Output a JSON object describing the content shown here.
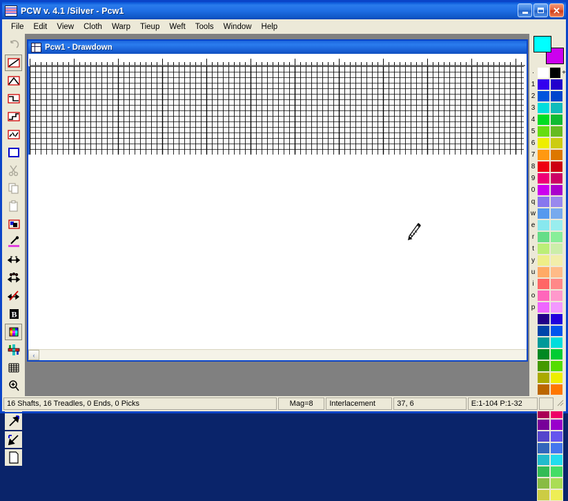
{
  "window": {
    "title": "PCW v. 4.1 /Silver - Pcw1",
    "icon": "weave-loom-icon",
    "minimize_label": "",
    "maximize_label": "",
    "close_label": "✕"
  },
  "menubar": {
    "items": [
      {
        "label": "File",
        "name": "menu-file"
      },
      {
        "label": "Edit",
        "name": "menu-edit"
      },
      {
        "label": "View",
        "name": "menu-view"
      },
      {
        "label": "Cloth",
        "name": "menu-cloth"
      },
      {
        "label": "Warp",
        "name": "menu-warp"
      },
      {
        "label": "Tieup",
        "name": "menu-tieup"
      },
      {
        "label": "Weft",
        "name": "menu-weft"
      },
      {
        "label": "Tools",
        "name": "menu-tools"
      },
      {
        "label": "Window",
        "name": "menu-window"
      },
      {
        "label": "Help",
        "name": "menu-help"
      }
    ]
  },
  "toolbar": {
    "tools": [
      {
        "name": "undo-tool",
        "icon": "undo-arrow-icon",
        "selected": false,
        "disabled": true
      },
      {
        "name": "straight-draw-tool",
        "icon": "straight-line-icon",
        "selected": true,
        "disabled": false
      },
      {
        "name": "point-draw-tool",
        "icon": "peak-line-icon",
        "selected": false,
        "disabled": false
      },
      {
        "name": "twill-draw-tool",
        "icon": "diagonal-line-icon",
        "selected": false,
        "disabled": false
      },
      {
        "name": "broken-draw-tool",
        "icon": "broken-line-icon",
        "selected": false,
        "disabled": false
      },
      {
        "name": "random-draw-tool",
        "icon": "scatter-line-icon",
        "selected": false,
        "disabled": false
      },
      {
        "name": "rectangle-select-tool",
        "icon": "rectangle-icon",
        "selected": false,
        "disabled": false
      },
      {
        "name": "cut-tool",
        "icon": "scissors-icon",
        "selected": false,
        "disabled": true
      },
      {
        "name": "copy-tool",
        "icon": "copy-pages-icon",
        "selected": false,
        "disabled": true
      },
      {
        "name": "paste-tool",
        "icon": "clipboard-icon",
        "selected": false,
        "disabled": true
      },
      {
        "name": "fill-tool",
        "icon": "paint-bucket-icon",
        "selected": false,
        "disabled": false
      },
      {
        "name": "eyedropper-tool",
        "icon": "eyedropper-icon",
        "selected": false,
        "disabled": false
      },
      {
        "name": "mirror-horizontal-tool",
        "icon": "double-arrow-icon",
        "selected": false,
        "disabled": false
      },
      {
        "name": "mirror-vertical-tool",
        "icon": "double-arrow-dots-icon",
        "selected": false,
        "disabled": false
      },
      {
        "name": "clear-tool",
        "icon": "no-entry-icon",
        "selected": false,
        "disabled": false
      },
      {
        "name": "text-tool",
        "icon": "bold-b-icon",
        "selected": false,
        "disabled": false
      },
      {
        "name": "color-view-tool",
        "icon": "color-grid-icon",
        "selected": true,
        "disabled": false
      },
      {
        "name": "interlacement-view-tool",
        "icon": "interlacement-icon",
        "selected": false,
        "disabled": false
      },
      {
        "name": "grid-view-tool",
        "icon": "grid-icon",
        "selected": false,
        "disabled": false
      },
      {
        "name": "zoom-in-tool",
        "icon": "magnifier-plus-icon",
        "selected": false,
        "disabled": false
      },
      {
        "name": "zoom-out-tool",
        "icon": "magnifier-minus-icon",
        "selected": false,
        "disabled": false
      },
      {
        "name": "expand-tool",
        "icon": "arrow-up-right-icon",
        "selected": false,
        "disabled": false
      },
      {
        "name": "shrink-tool",
        "icon": "arrow-down-left-icon",
        "selected": false,
        "disabled": false
      },
      {
        "name": "new-document-tool",
        "icon": "page-icon",
        "selected": false,
        "disabled": false
      }
    ]
  },
  "document": {
    "title": "Pcw1  - Drawdown",
    "icon": "document-window-icon",
    "cursor": "pencil-cursor",
    "grid": {
      "columns": 104,
      "rows": 16,
      "cell_size": 8,
      "major_every": 8
    },
    "scrollbar": {
      "left_arrow": "‹"
    }
  },
  "palette": {
    "foreground": "#00ffff",
    "background": "#cc00ee",
    "plus_label": "+",
    "rows": [
      {
        "key": "·",
        "left": "#ffffff",
        "right": "#000000",
        "plus": true
      },
      {
        "key": "1",
        "left": "#3300ee",
        "right": "#2200cc"
      },
      {
        "key": "2",
        "left": "#0055dd",
        "right": "#0044cc"
      },
      {
        "key": "3",
        "left": "#00dddd",
        "right": "#11bbbb"
      },
      {
        "key": "4",
        "left": "#00dd22",
        "right": "#11bb33"
      },
      {
        "key": "5",
        "left": "#66dd11",
        "right": "#66bb22"
      },
      {
        "key": "6",
        "left": "#eeee00",
        "right": "#cccc11"
      },
      {
        "key": "7",
        "left": "#ff9911",
        "right": "#dd7700"
      },
      {
        "key": "8",
        "left": "#ee0011",
        "right": "#cc0011"
      },
      {
        "key": "9",
        "left": "#ee0077",
        "right": "#cc0066"
      },
      {
        "key": "0",
        "left": "#cc00ee",
        "right": "#aa00cc"
      },
      {
        "key": "q",
        "left": "#8877ee",
        "right": "#9988ee"
      },
      {
        "key": "w",
        "left": "#5599ee",
        "right": "#77aaee"
      },
      {
        "key": "e",
        "left": "#88e8ee",
        "right": "#99eeee"
      },
      {
        "key": "r",
        "left": "#66dd88",
        "right": "#88ee99"
      },
      {
        "key": "t",
        "left": "#bbee77",
        "right": "#cceeaa"
      },
      {
        "key": "y",
        "left": "#eeee88",
        "right": "#f2eeaa"
      },
      {
        "key": "u",
        "left": "#ffaa66",
        "right": "#ffbb88"
      },
      {
        "key": "i",
        "left": "#ff6666",
        "right": "#ff8888"
      },
      {
        "key": "o",
        "left": "#ff66bb",
        "right": "#ff99cc"
      },
      {
        "key": "p",
        "left": "#ee66ff",
        "right": "#f299ff"
      },
      {
        "key": "",
        "left": "#220088",
        "right": "#2200dd"
      },
      {
        "key": "",
        "left": "#0044aa",
        "right": "#0055ee"
      },
      {
        "key": "",
        "left": "#009999",
        "right": "#00dddd"
      },
      {
        "key": "",
        "left": "#008822",
        "right": "#00cc33"
      },
      {
        "key": "",
        "left": "#449900",
        "right": "#55dd00"
      },
      {
        "key": "",
        "left": "#aaaa00",
        "right": "#eeee00"
      },
      {
        "key": "",
        "left": "#bb6600",
        "right": "#ff7700"
      },
      {
        "key": "",
        "left": "#aa0000",
        "right": "#ee0000"
      },
      {
        "key": "",
        "left": "#aa0055",
        "right": "#ee0066"
      },
      {
        "key": "",
        "left": "#770099",
        "right": "#9900cc"
      },
      {
        "key": "",
        "left": "#5544cc",
        "right": "#6655ee"
      },
      {
        "key": "",
        "left": "#3366bb",
        "right": "#4477ee"
      },
      {
        "key": "",
        "left": "#22bbcc",
        "right": "#22ddee"
      },
      {
        "key": "",
        "left": "#33bb55",
        "right": "#44dd66"
      },
      {
        "key": "",
        "left": "#88bb44",
        "right": "#aadd55"
      },
      {
        "key": "",
        "left": "#cccc44",
        "right": "#eeee55"
      }
    ]
  },
  "statusbar": {
    "summary": "16 Shafts, 16 Treadles, 0 Ends, 0 Picks",
    "magnification": "Mag=8",
    "mode": "Interlacement",
    "coordinates": "37, 6",
    "range": "E:1-104  P:1-32"
  }
}
